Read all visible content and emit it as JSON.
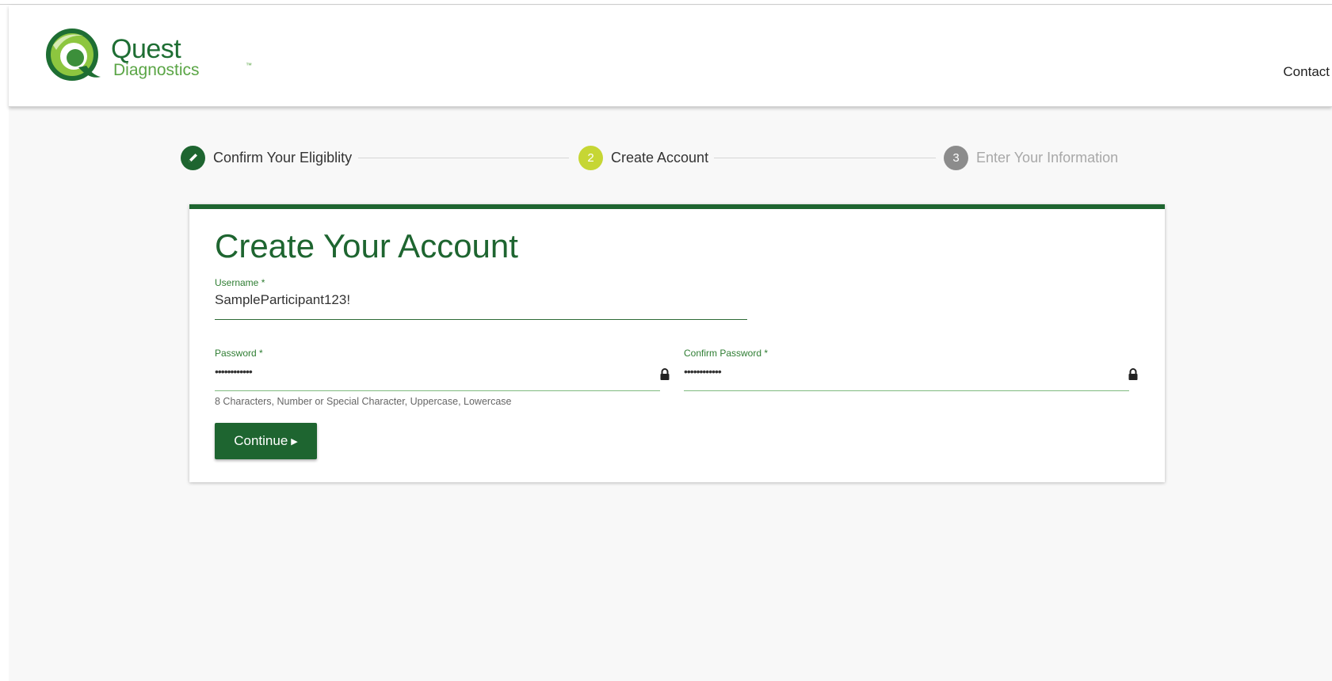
{
  "header": {
    "brand_name": "Quest",
    "brand_sub": "Diagnostics",
    "brand_tm": "™",
    "contact_link": "Contact"
  },
  "stepper": {
    "steps": [
      {
        "number": "",
        "label": "Confirm Your Eligiblity",
        "state": "completed",
        "icon": "pencil-icon"
      },
      {
        "number": "2",
        "label": "Create Account",
        "state": "active"
      },
      {
        "number": "3",
        "label": "Enter Your Information",
        "state": "upcoming"
      }
    ]
  },
  "form": {
    "title": "Create Your Account",
    "username": {
      "label": "Username *",
      "value": "SampleParticipant123!"
    },
    "password": {
      "label": "Password *",
      "value": "••••••••••••",
      "hint": "8 Characters, Number or Special Character, Uppercase, Lowercase",
      "icon": "lock-icon"
    },
    "confirm_password": {
      "label": "Confirm Password *",
      "value": "••••••••••••",
      "icon": "lock-icon"
    },
    "continue_label": "Continue"
  },
  "colors": {
    "brand_green": "#1e6530",
    "brand_light_green": "#5aa545",
    "active_step": "#c6d634",
    "upcoming_step": "#8c8c8c"
  }
}
